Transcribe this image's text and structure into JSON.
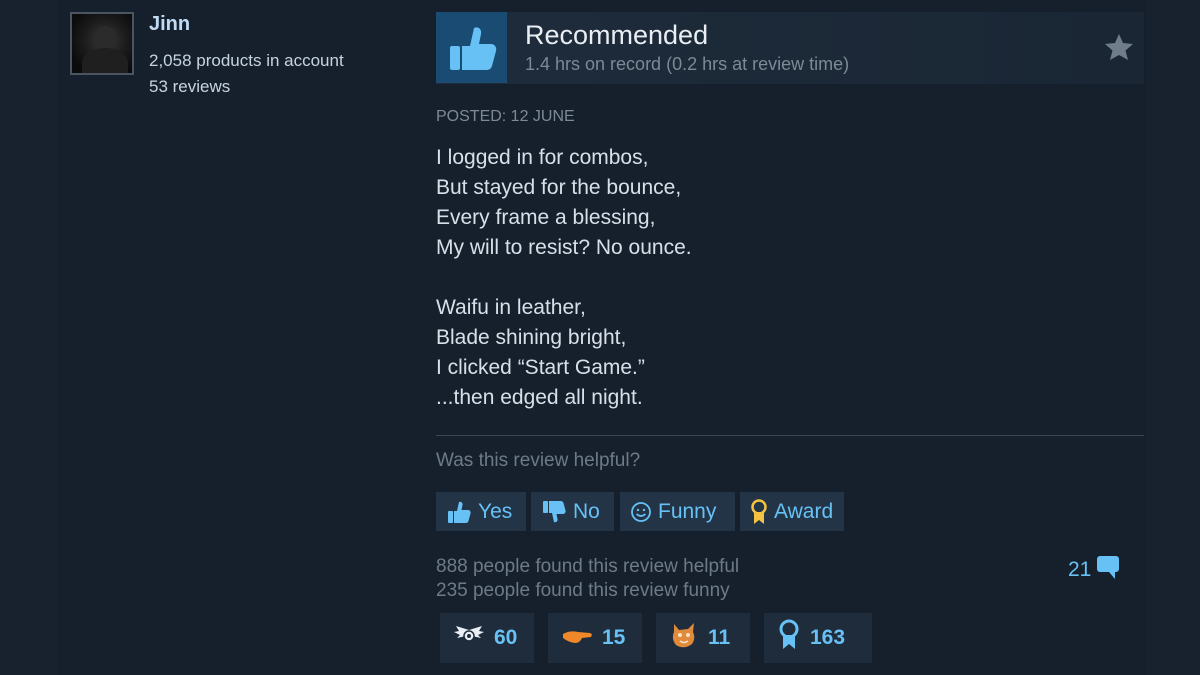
{
  "reviewer": {
    "name": "Jinn",
    "products": "2,058 products in account",
    "reviews": "53 reviews"
  },
  "review": {
    "verdict": "Recommended",
    "hours": "1.4 hrs on record (0.2 hrs at review time)",
    "posted": "POSTED: 12 JUNE",
    "lines": [
      "I logged in for combos,",
      "But stayed for the bounce,",
      "Every frame a blessing,",
      "My will to resist? No ounce.",
      "Waifu in leather,",
      "Blade shining bright,",
      "I clicked “Start Game.”",
      "...then edged all night."
    ]
  },
  "feedback": {
    "question": "Was this review helpful?",
    "yes_label": "Yes",
    "no_label": "No",
    "funny_label": "Funny",
    "award_label": "Award",
    "helpful_count": "888 people found this review helpful",
    "funny_count": "235 people found this review funny",
    "comments": "21"
  },
  "awards": [
    {
      "icon": "winged-award-icon",
      "count": "60"
    },
    {
      "icon": "hand-award-icon",
      "count": "15"
    },
    {
      "icon": "cat-award-icon",
      "count": "11"
    },
    {
      "icon": "ribbon-award-icon",
      "count": "163"
    }
  ],
  "colors": {
    "accent": "#67c1f5",
    "background": "#1b2838",
    "thumb_bg": "#1a4b73",
    "award_gold": "#f5c342"
  }
}
